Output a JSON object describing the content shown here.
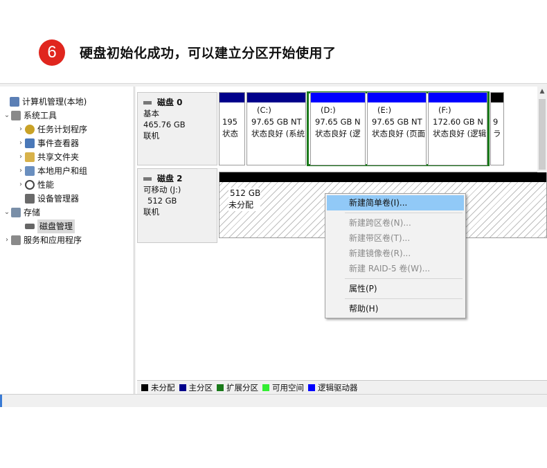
{
  "step": {
    "number": "6",
    "title": "硬盘初始化成功，可以建立分区开始使用了"
  },
  "tree": {
    "items": [
      {
        "label": "计算机管理(本地)",
        "arrow": "",
        "icon_color": "#5b7fb5"
      },
      {
        "label": "系统工具",
        "arrow": "⌄",
        "icon_color": "#8a8a8a"
      },
      {
        "label": "任务计划程序",
        "arrow": "›",
        "icon_color": "#c9a227"
      },
      {
        "label": "事件查看器",
        "arrow": "›",
        "icon_color": "#4a78b8"
      },
      {
        "label": "共享文件夹",
        "arrow": "›",
        "icon_color": "#d8b24a"
      },
      {
        "label": "本地用户和组",
        "arrow": "›",
        "icon_color": "#6a8fbf"
      },
      {
        "label": "性能",
        "arrow": "›",
        "icon_color": "#444444"
      },
      {
        "label": "设备管理器",
        "arrow": "",
        "icon_color": "#6a6a6a"
      },
      {
        "label": "存储",
        "arrow": "⌄",
        "icon_color": "#7a8fa8"
      },
      {
        "label": "磁盘管理",
        "arrow": "",
        "icon_color": "#666666"
      },
      {
        "label": "服务和应用程序",
        "arrow": "›",
        "icon_color": "#8a8a8a"
      }
    ]
  },
  "disk0": {
    "name": "磁盘 0",
    "type": "基本",
    "size": "465.76 GB",
    "status": "联机",
    "partitions": [
      {
        "letter": "",
        "size": "195",
        "status": "状态",
        "kind": "primary"
      },
      {
        "letter": "(C:)",
        "size": "97.65 GB NT",
        "status": "状态良好 (系统",
        "kind": "primary"
      },
      {
        "letter": "(D:)",
        "size": "97.65 GB N",
        "status": "状态良好 (逻",
        "kind": "logical"
      },
      {
        "letter": "(E:)",
        "size": "97.65 GB NT",
        "status": "状态良好 (页面",
        "kind": "logical"
      },
      {
        "letter": "(F:)",
        "size": "172.60 GB N",
        "status": "状态良好 (逻辑",
        "kind": "logical"
      },
      {
        "letter": "",
        "size": "9",
        "status": "ラ",
        "kind": "unallocated"
      }
    ]
  },
  "disk2": {
    "name": "磁盘 2",
    "type": "可移动 (J:)",
    "size": "512 GB",
    "status": "联机",
    "unalloc_size": "512 GB",
    "unalloc_label": "未分配"
  },
  "context_menu": {
    "items": [
      {
        "label": "新建简单卷(I)...",
        "state": "highlighted"
      },
      {
        "label": "新建跨区卷(N)...",
        "state": "disabled"
      },
      {
        "label": "新建带区卷(T)...",
        "state": "disabled"
      },
      {
        "label": "新建镜像卷(R)...",
        "state": "disabled"
      },
      {
        "label": "新建 RAID-5 卷(W)...",
        "state": "disabled"
      },
      {
        "label": "属性(P)",
        "state": "normal"
      },
      {
        "label": "帮助(H)",
        "state": "normal"
      }
    ]
  },
  "legend": [
    {
      "label": "未分配",
      "color": "#000000"
    },
    {
      "label": "主分区",
      "color": "#00008b"
    },
    {
      "label": "扩展分区",
      "color": "#1a7a1a"
    },
    {
      "label": "可用空间",
      "color": "#33ee33"
    },
    {
      "label": "逻辑驱动器",
      "color": "#0000ff"
    }
  ],
  "colors": {
    "step_badge": "#e0261e",
    "menu_highlight": "#91c9f7",
    "extended_frame": "#1a7a1a"
  }
}
